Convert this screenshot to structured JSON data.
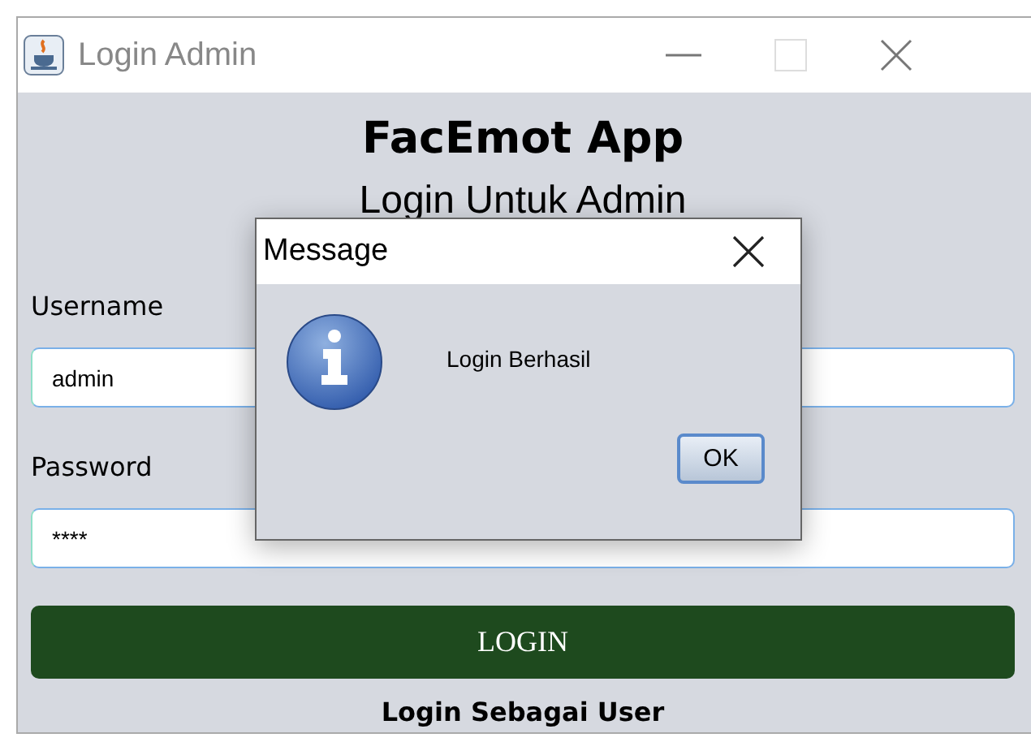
{
  "window": {
    "title": "Login Admin"
  },
  "app_title": "FacEmot App",
  "subtitle": "Login Untuk Admin",
  "fields": [
    {
      "label": "Username",
      "value": "admin"
    },
    {
      "label": "Password",
      "value": "****"
    }
  ],
  "login_button": "LOGIN",
  "user_link": "Login Sebagai User",
  "dialog": {
    "title": "Message",
    "message": "Login Berhasil",
    "button": "OK"
  }
}
